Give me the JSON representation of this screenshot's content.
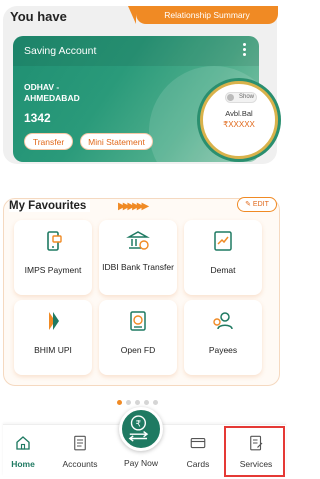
{
  "balance_card": {
    "title": "You have",
    "relationship_tab": "Relationship Summary",
    "account_name": "Saving Account",
    "branch_line1": "ODHAV -",
    "branch_line2": "AHMEDABAD",
    "account_number": "1342",
    "transfer_label": "Transfer",
    "mini_statement_label": "Mini Statement",
    "show_label": "Show",
    "avbl_label": "Avbl.Bal",
    "balance_mask": "₹XXXXX"
  },
  "favourites": {
    "title": "My Favourites",
    "edit_label": "EDIT",
    "items": [
      {
        "label": "IMPS Payment",
        "icon": "imps-phone-icon"
      },
      {
        "label": "IDBI Bank Transfer",
        "icon": "bank-transfer-icon"
      },
      {
        "label": "Demat",
        "icon": "demat-chart-icon"
      },
      {
        "label": "BHIM UPI",
        "icon": "bhim-upi-icon"
      },
      {
        "label": "Open FD",
        "icon": "fixed-deposit-icon"
      },
      {
        "label": "Payees",
        "icon": "payees-icon"
      }
    ],
    "page_count": 5,
    "active_page": 1
  },
  "bottom_nav": {
    "home": "Home",
    "accounts": "Accounts",
    "pay_now": "Pay Now",
    "cards": "Cards",
    "services": "Services"
  },
  "colors": {
    "brand_green": "#1f7a62",
    "accent_orange": "#f08a24",
    "highlight_red": "#e53935"
  }
}
